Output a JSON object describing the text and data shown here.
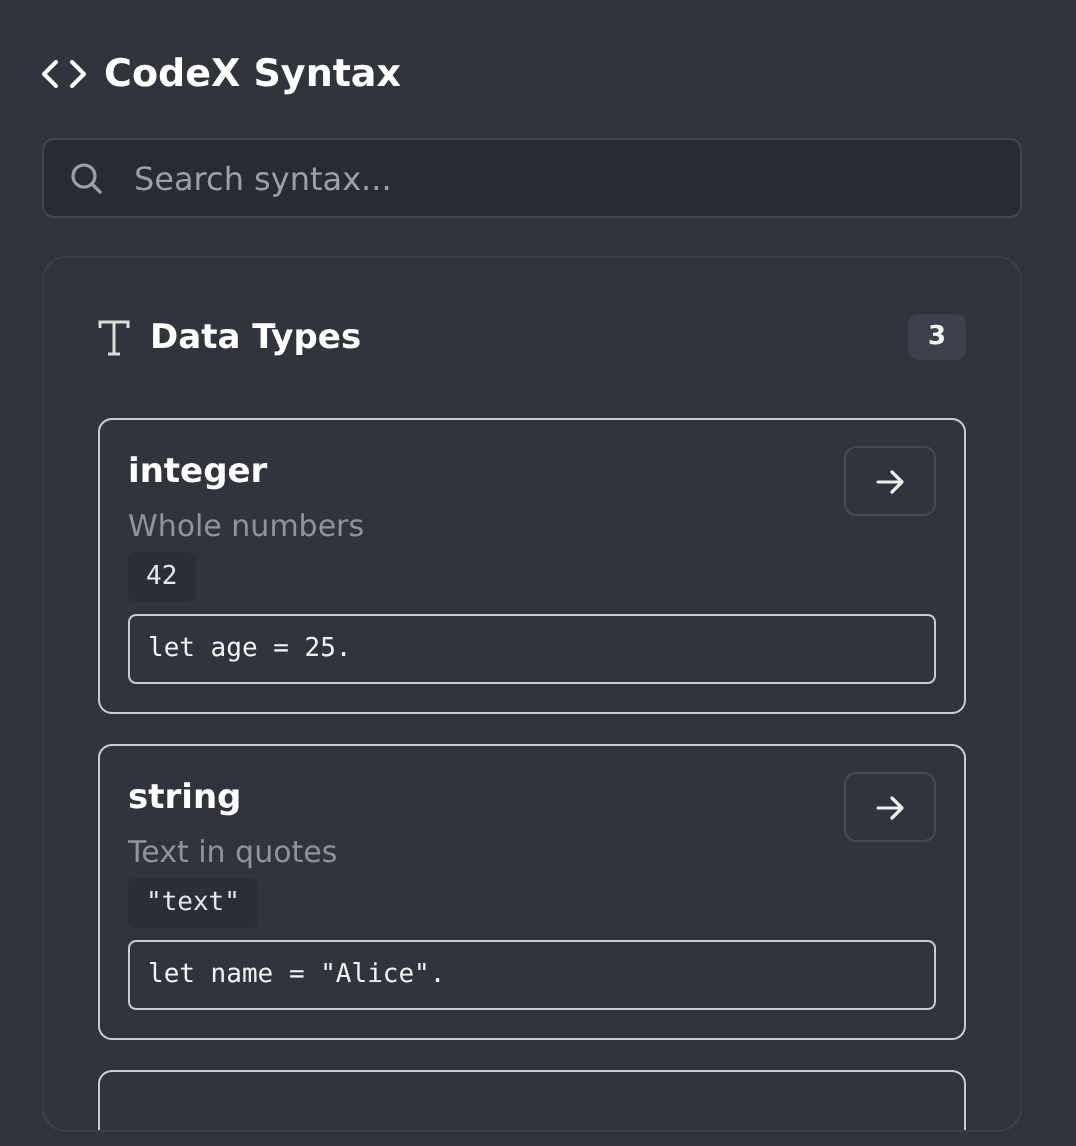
{
  "app": {
    "title": "CodeX Syntax"
  },
  "search": {
    "placeholder": "Search syntax..."
  },
  "section": {
    "title": "Data Types",
    "count": "3",
    "items": [
      {
        "name": "integer",
        "description": "Whole numbers",
        "example": "42",
        "code": "let age = 25."
      },
      {
        "name": "string",
        "description": "Text in quotes",
        "example": "\"text\"",
        "code": "let name = \"Alice\"."
      }
    ]
  }
}
